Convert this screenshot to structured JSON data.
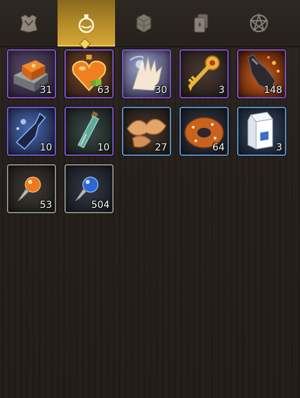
{
  "tabs": [
    {
      "name": "equipment",
      "icon": "armor-icon",
      "active": false
    },
    {
      "name": "consumables",
      "icon": "potion-icon",
      "active": true
    },
    {
      "name": "materials",
      "icon": "cubes-icon",
      "active": false
    },
    {
      "name": "cards",
      "icon": "cards-icon",
      "active": false
    },
    {
      "name": "special",
      "icon": "pentagram-icon",
      "active": false
    }
  ],
  "items": [
    {
      "icon": "orange-box-icon",
      "quantity": "31",
      "rarity": "purple"
    },
    {
      "icon": "heart-potion-icon",
      "quantity": "63",
      "rarity": "purple"
    },
    {
      "icon": "glowing-hand-icon",
      "quantity": "30",
      "rarity": "purple"
    },
    {
      "icon": "ornate-key-icon",
      "quantity": "3",
      "rarity": "purple"
    },
    {
      "icon": "fire-bottle-icon",
      "quantity": "148",
      "rarity": "purple"
    },
    {
      "icon": "blue-bottle-icon",
      "quantity": "10",
      "rarity": "purple"
    },
    {
      "icon": "vial-icon",
      "quantity": "10",
      "rarity": "purple"
    },
    {
      "icon": "fortune-cookie-icon",
      "quantity": "27",
      "rarity": "blue"
    },
    {
      "icon": "donut-icon",
      "quantity": "64",
      "rarity": "blue"
    },
    {
      "icon": "milk-carton-icon",
      "quantity": "3",
      "rarity": "blue"
    },
    {
      "icon": "orange-gem-icon",
      "quantity": "53",
      "rarity": "gray"
    },
    {
      "icon": "blue-gem-icon",
      "quantity": "504",
      "rarity": "gray"
    }
  ],
  "colors": {
    "active_tab": "#c4962e",
    "rarity_purple": "#7a52c4",
    "rarity_blue": "#5a8fc0",
    "rarity_gray": "#8a8a86"
  }
}
